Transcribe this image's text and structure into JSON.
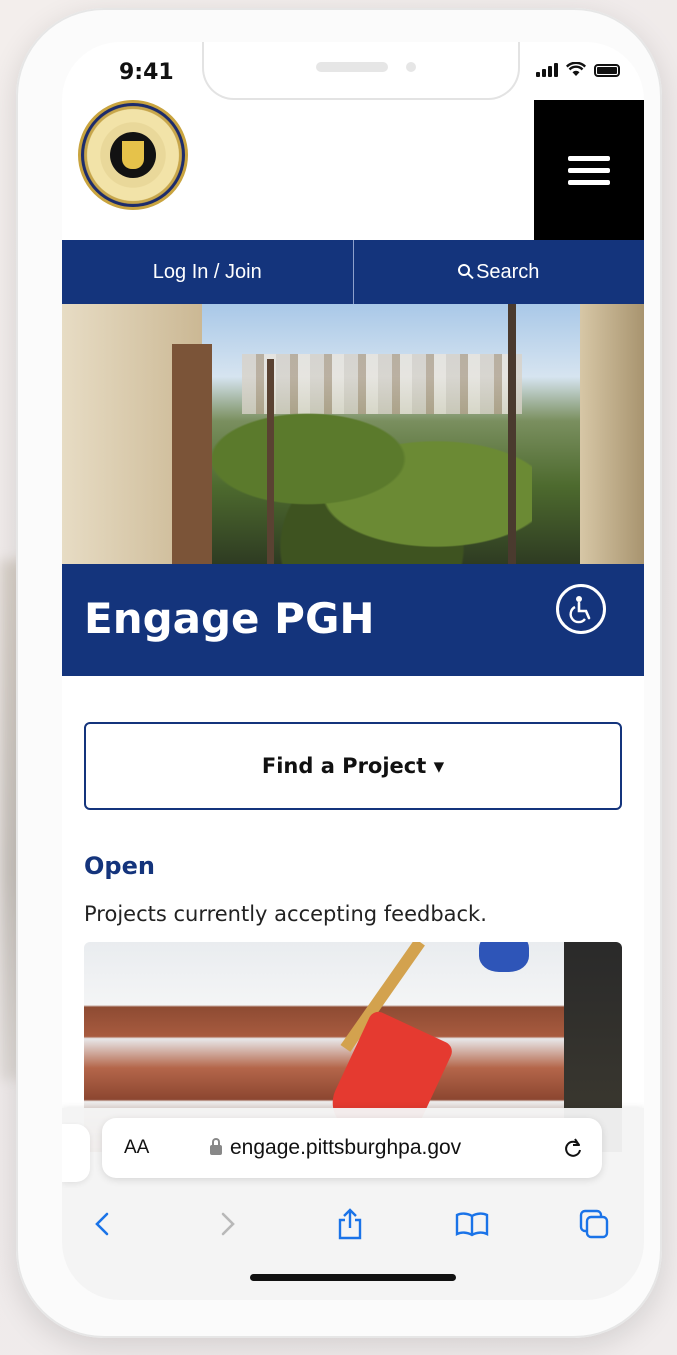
{
  "status_bar": {
    "time": "9:41"
  },
  "site": {
    "seal_alt": "City of Pittsburgh seal",
    "menu_icon": "hamburger-menu-icon",
    "nav": {
      "login_label": "Log In / Join",
      "search_label": "Search"
    },
    "banner_title": "Engage PGH",
    "accessibility_icon": "accessibility-icon"
  },
  "main": {
    "find_project_label": "Find a Project ▾",
    "section_title": "Open",
    "section_desc": "Projects currently accepting feedback."
  },
  "browser": {
    "text_size_label": "AA",
    "url": "engage.pittsburghpa.gov",
    "toolbar_icons": [
      "back-icon",
      "forward-icon",
      "share-icon",
      "bookmarks-icon",
      "tabs-icon"
    ]
  },
  "colors": {
    "brand_navy": "#14347c",
    "safari_blue": "#1a73e8"
  }
}
